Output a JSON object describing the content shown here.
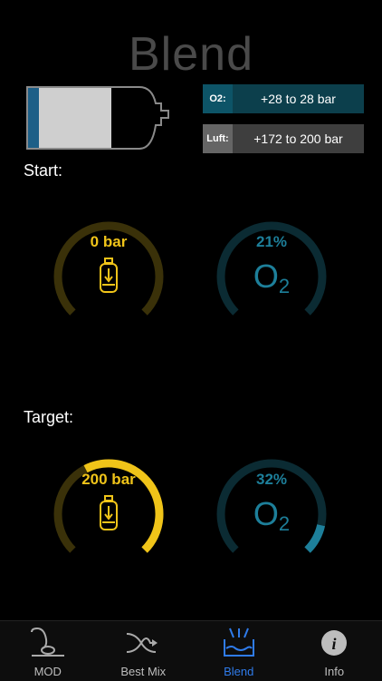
{
  "page": {
    "title": "Blend"
  },
  "mix": {
    "o2_label": "O2:",
    "o2_value": "+28 to 28 bar",
    "air_label": "Luft:",
    "air_value": "+172 to 200 bar"
  },
  "start": {
    "label": "Start:",
    "pressure_text": "0 bar",
    "pressure_fraction": 0,
    "o2_text": "21%",
    "o2_fraction": 0.0
  },
  "target": {
    "label": "Target:",
    "pressure_text": "200 bar",
    "pressure_fraction": 0.6,
    "o2_text": "32%",
    "o2_fraction": 0.12
  },
  "gauge_symbol": {
    "main": "O",
    "sub": "2"
  },
  "tabs": [
    {
      "label": "MOD",
      "icon": "mod-icon"
    },
    {
      "label": "Best Mix",
      "icon": "best-mix-icon"
    },
    {
      "label": "Blend",
      "icon": "blend-icon",
      "active": true
    },
    {
      "label": "Info",
      "icon": "info-icon"
    }
  ],
  "colors": {
    "pressure": "#f0c419",
    "pressure_track": "#3a3109",
    "o2": "#1d7f9a",
    "o2_track": "#0b2b33",
    "active_tab": "#2f7bea"
  }
}
